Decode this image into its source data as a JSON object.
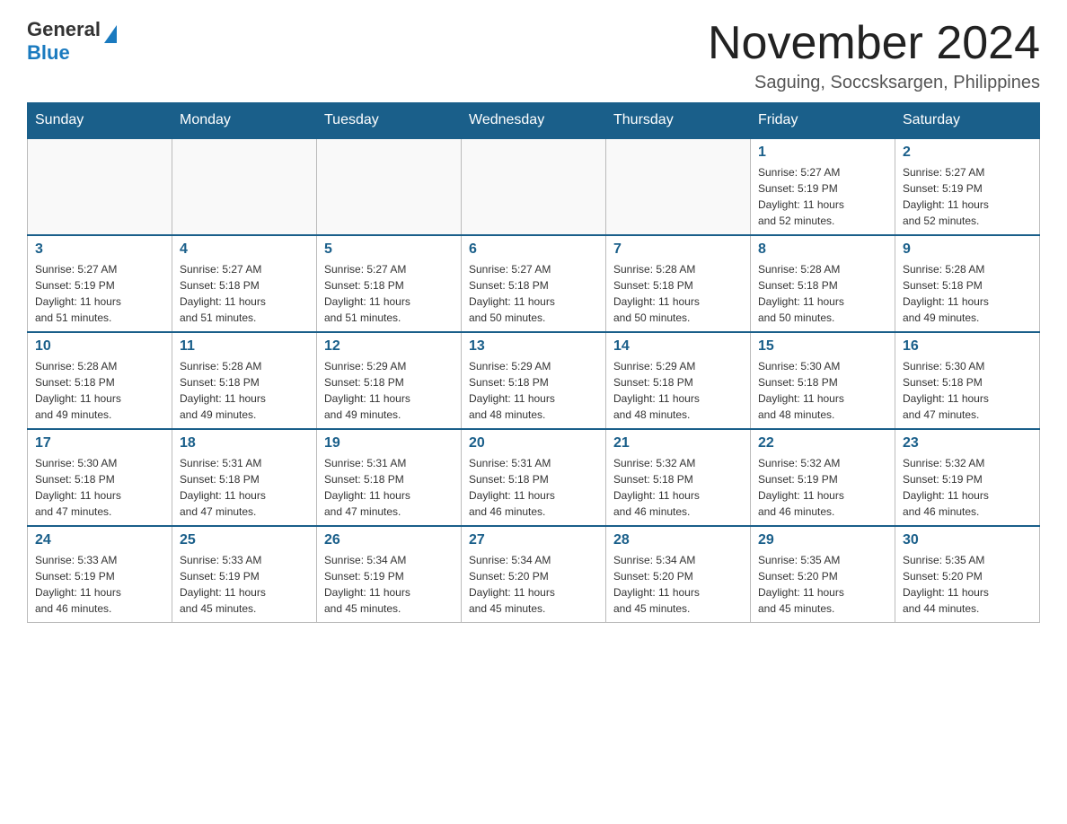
{
  "logo": {
    "general": "General",
    "blue": "Blue"
  },
  "title": "November 2024",
  "location": "Saguing, Soccsksargen, Philippines",
  "days_of_week": [
    "Sunday",
    "Monday",
    "Tuesday",
    "Wednesday",
    "Thursday",
    "Friday",
    "Saturday"
  ],
  "weeks": [
    [
      {
        "day": "",
        "info": ""
      },
      {
        "day": "",
        "info": ""
      },
      {
        "day": "",
        "info": ""
      },
      {
        "day": "",
        "info": ""
      },
      {
        "day": "",
        "info": ""
      },
      {
        "day": "1",
        "info": "Sunrise: 5:27 AM\nSunset: 5:19 PM\nDaylight: 11 hours\nand 52 minutes."
      },
      {
        "day": "2",
        "info": "Sunrise: 5:27 AM\nSunset: 5:19 PM\nDaylight: 11 hours\nand 52 minutes."
      }
    ],
    [
      {
        "day": "3",
        "info": "Sunrise: 5:27 AM\nSunset: 5:19 PM\nDaylight: 11 hours\nand 51 minutes."
      },
      {
        "day": "4",
        "info": "Sunrise: 5:27 AM\nSunset: 5:18 PM\nDaylight: 11 hours\nand 51 minutes."
      },
      {
        "day": "5",
        "info": "Sunrise: 5:27 AM\nSunset: 5:18 PM\nDaylight: 11 hours\nand 51 minutes."
      },
      {
        "day": "6",
        "info": "Sunrise: 5:27 AM\nSunset: 5:18 PM\nDaylight: 11 hours\nand 50 minutes."
      },
      {
        "day": "7",
        "info": "Sunrise: 5:28 AM\nSunset: 5:18 PM\nDaylight: 11 hours\nand 50 minutes."
      },
      {
        "day": "8",
        "info": "Sunrise: 5:28 AM\nSunset: 5:18 PM\nDaylight: 11 hours\nand 50 minutes."
      },
      {
        "day": "9",
        "info": "Sunrise: 5:28 AM\nSunset: 5:18 PM\nDaylight: 11 hours\nand 49 minutes."
      }
    ],
    [
      {
        "day": "10",
        "info": "Sunrise: 5:28 AM\nSunset: 5:18 PM\nDaylight: 11 hours\nand 49 minutes."
      },
      {
        "day": "11",
        "info": "Sunrise: 5:28 AM\nSunset: 5:18 PM\nDaylight: 11 hours\nand 49 minutes."
      },
      {
        "day": "12",
        "info": "Sunrise: 5:29 AM\nSunset: 5:18 PM\nDaylight: 11 hours\nand 49 minutes."
      },
      {
        "day": "13",
        "info": "Sunrise: 5:29 AM\nSunset: 5:18 PM\nDaylight: 11 hours\nand 48 minutes."
      },
      {
        "day": "14",
        "info": "Sunrise: 5:29 AM\nSunset: 5:18 PM\nDaylight: 11 hours\nand 48 minutes."
      },
      {
        "day": "15",
        "info": "Sunrise: 5:30 AM\nSunset: 5:18 PM\nDaylight: 11 hours\nand 48 minutes."
      },
      {
        "day": "16",
        "info": "Sunrise: 5:30 AM\nSunset: 5:18 PM\nDaylight: 11 hours\nand 47 minutes."
      }
    ],
    [
      {
        "day": "17",
        "info": "Sunrise: 5:30 AM\nSunset: 5:18 PM\nDaylight: 11 hours\nand 47 minutes."
      },
      {
        "day": "18",
        "info": "Sunrise: 5:31 AM\nSunset: 5:18 PM\nDaylight: 11 hours\nand 47 minutes."
      },
      {
        "day": "19",
        "info": "Sunrise: 5:31 AM\nSunset: 5:18 PM\nDaylight: 11 hours\nand 47 minutes."
      },
      {
        "day": "20",
        "info": "Sunrise: 5:31 AM\nSunset: 5:18 PM\nDaylight: 11 hours\nand 46 minutes."
      },
      {
        "day": "21",
        "info": "Sunrise: 5:32 AM\nSunset: 5:18 PM\nDaylight: 11 hours\nand 46 minutes."
      },
      {
        "day": "22",
        "info": "Sunrise: 5:32 AM\nSunset: 5:19 PM\nDaylight: 11 hours\nand 46 minutes."
      },
      {
        "day": "23",
        "info": "Sunrise: 5:32 AM\nSunset: 5:19 PM\nDaylight: 11 hours\nand 46 minutes."
      }
    ],
    [
      {
        "day": "24",
        "info": "Sunrise: 5:33 AM\nSunset: 5:19 PM\nDaylight: 11 hours\nand 46 minutes."
      },
      {
        "day": "25",
        "info": "Sunrise: 5:33 AM\nSunset: 5:19 PM\nDaylight: 11 hours\nand 45 minutes."
      },
      {
        "day": "26",
        "info": "Sunrise: 5:34 AM\nSunset: 5:19 PM\nDaylight: 11 hours\nand 45 minutes."
      },
      {
        "day": "27",
        "info": "Sunrise: 5:34 AM\nSunset: 5:20 PM\nDaylight: 11 hours\nand 45 minutes."
      },
      {
        "day": "28",
        "info": "Sunrise: 5:34 AM\nSunset: 5:20 PM\nDaylight: 11 hours\nand 45 minutes."
      },
      {
        "day": "29",
        "info": "Sunrise: 5:35 AM\nSunset: 5:20 PM\nDaylight: 11 hours\nand 45 minutes."
      },
      {
        "day": "30",
        "info": "Sunrise: 5:35 AM\nSunset: 5:20 PM\nDaylight: 11 hours\nand 44 minutes."
      }
    ]
  ]
}
